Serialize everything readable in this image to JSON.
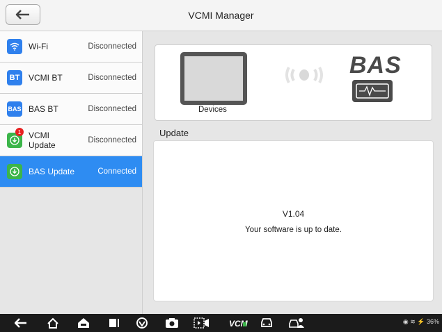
{
  "header": {
    "title": "VCMI Manager"
  },
  "sidebar": {
    "items": [
      {
        "label": "Wi-Fi",
        "status": "Disconnected",
        "icon": "wifi-icon"
      },
      {
        "label": "VCMI BT",
        "status": "Disconnected",
        "icon_text": "BT"
      },
      {
        "label": "BAS BT",
        "status": "Disconnected",
        "icon_text": "BAS"
      },
      {
        "label": "VCMI Update",
        "status": "Disconnected",
        "badge": "1",
        "icon": "download-icon"
      },
      {
        "label": "BAS Update",
        "status": "Connected",
        "icon": "download-icon"
      }
    ]
  },
  "devices": {
    "label": "Devices",
    "logo_text": "BAS"
  },
  "update": {
    "title": "Update",
    "version": "V1.04",
    "message": "Your software is up to date."
  },
  "statusbar": {
    "text": "36%"
  },
  "colors": {
    "accent": "#2e8cf2",
    "bt": "#2f80ed",
    "update_green": "#3cb54a",
    "badge": "#e82020"
  }
}
